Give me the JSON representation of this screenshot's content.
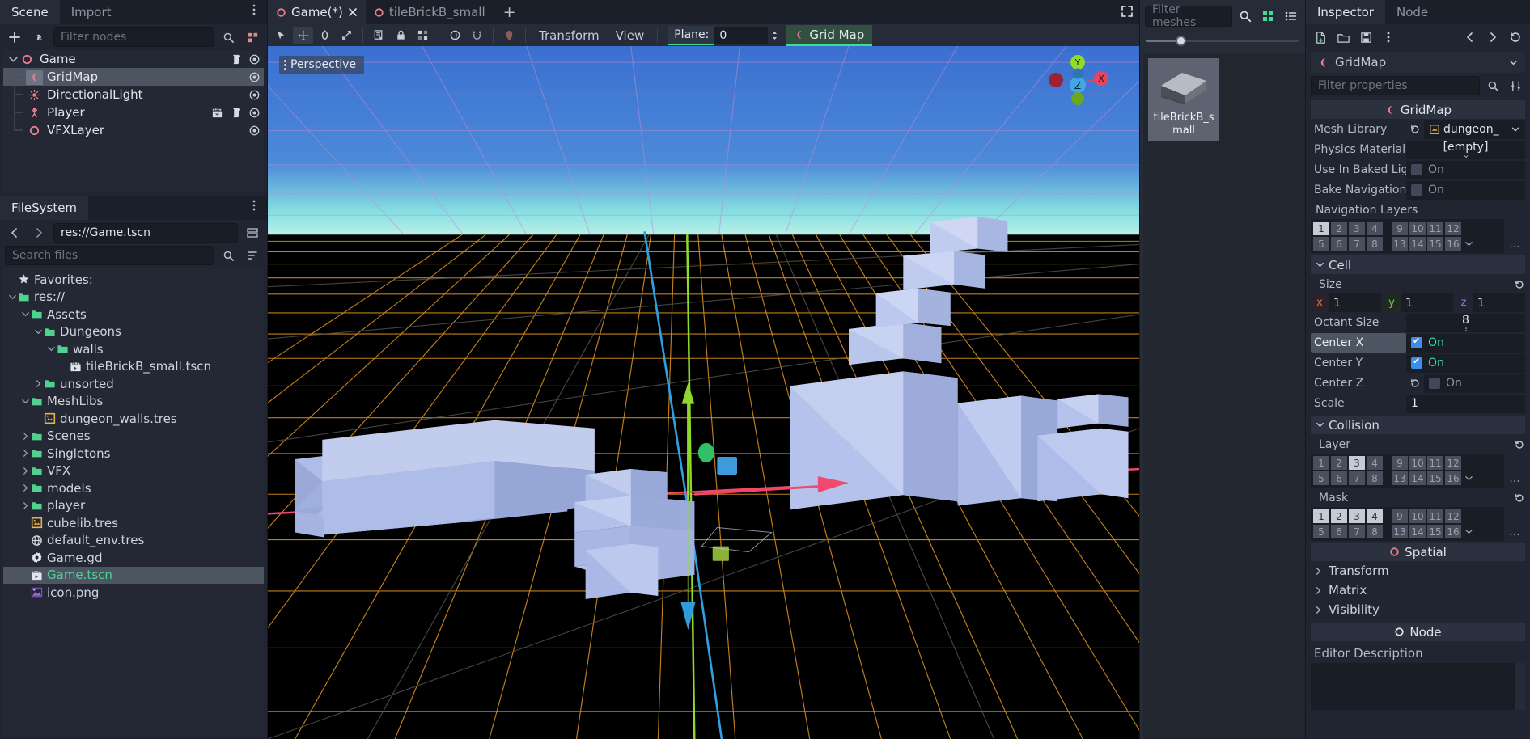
{
  "scene_panel": {
    "tabs": [
      {
        "label": "Scene",
        "active": true
      },
      {
        "label": "Import",
        "active": false
      }
    ],
    "filter_placeholder": "Filter nodes",
    "add_icon": "plus-icon",
    "link_icon": "link-icon",
    "menu_icon": "kebab-menu-icon",
    "nodes": [
      {
        "label": "Game",
        "depth": 0,
        "icon": "spatial-node-icon",
        "selected": false,
        "expanded": true,
        "extra_icons": [
          "script-icon"
        ]
      },
      {
        "label": "GridMap",
        "depth": 1,
        "icon": "gridmap-node-icon",
        "selected": true,
        "expanded": false,
        "extra_icons": []
      },
      {
        "label": "DirectionalLight",
        "depth": 1,
        "icon": "directional-light-icon",
        "selected": false,
        "expanded": false,
        "extra_icons": []
      },
      {
        "label": "Player",
        "depth": 1,
        "icon": "player-node-icon",
        "selected": false,
        "expanded": false,
        "extra_icons": [
          "group-icon",
          "script-icon"
        ]
      },
      {
        "label": "VFXLayer",
        "depth": 1,
        "icon": "spatial-node-icon",
        "selected": false,
        "expanded": false,
        "extra_icons": []
      }
    ]
  },
  "filesystem": {
    "title": "FileSystem",
    "path_value": "res://Game.tscn",
    "search_placeholder": "Search files",
    "back_icon": "chevron-left-icon",
    "forward_icon": "chevron-right-icon",
    "split_icon": "split-mode-icon",
    "sort_icon": "sort-icon",
    "items": [
      {
        "label": "Favorites:",
        "depth": 0,
        "icon": "star-icon",
        "arrow": "",
        "selected": false
      },
      {
        "label": "res://",
        "depth": 0,
        "icon": "folder-icon",
        "arrow": "v",
        "selected": false
      },
      {
        "label": "Assets",
        "depth": 1,
        "icon": "folder-icon",
        "arrow": "v",
        "selected": false
      },
      {
        "label": "Dungeons",
        "depth": 2,
        "icon": "folder-icon",
        "arrow": "v",
        "selected": false
      },
      {
        "label": "walls",
        "depth": 3,
        "icon": "folder-icon",
        "arrow": "v",
        "selected": false
      },
      {
        "label": "tileBrickB_small.tscn",
        "depth": 4,
        "icon": "scene-file-icon",
        "arrow": "",
        "selected": false
      },
      {
        "label": "unsorted",
        "depth": 2,
        "icon": "folder-icon",
        "arrow": ">",
        "selected": false
      },
      {
        "label": "MeshLibs",
        "depth": 1,
        "icon": "folder-icon",
        "arrow": "v",
        "selected": false
      },
      {
        "label": "dungeon_walls.tres",
        "depth": 2,
        "icon": "meshlib-icon",
        "arrow": "",
        "selected": false
      },
      {
        "label": "Scenes",
        "depth": 1,
        "icon": "folder-icon",
        "arrow": ">",
        "selected": false
      },
      {
        "label": "Singletons",
        "depth": 1,
        "icon": "folder-icon",
        "arrow": ">",
        "selected": false
      },
      {
        "label": "VFX",
        "depth": 1,
        "icon": "folder-icon",
        "arrow": ">",
        "selected": false
      },
      {
        "label": "models",
        "depth": 1,
        "icon": "folder-icon",
        "arrow": ">",
        "selected": false
      },
      {
        "label": "player",
        "depth": 1,
        "icon": "folder-icon",
        "arrow": ">",
        "selected": false
      },
      {
        "label": "cubelib.tres",
        "depth": 1,
        "icon": "meshlib-icon",
        "arrow": "",
        "selected": false
      },
      {
        "label": "default_env.tres",
        "depth": 1,
        "icon": "environment-icon",
        "arrow": "",
        "selected": false
      },
      {
        "label": "Game.gd",
        "depth": 1,
        "icon": "gdscript-icon",
        "arrow": "",
        "selected": false
      },
      {
        "label": "Game.tscn",
        "depth": 1,
        "icon": "scene-file-icon",
        "arrow": "",
        "selected": true
      },
      {
        "label": "icon.png",
        "depth": 1,
        "icon": "image-file-icon",
        "arrow": "",
        "selected": false
      }
    ]
  },
  "editor_tabs": {
    "items": [
      {
        "label": "Game(*)",
        "active": true,
        "closable": true
      },
      {
        "label": "tileBrickB_small",
        "active": false,
        "closable": false
      }
    ],
    "add_label": "+",
    "fullscreen_icon": "fullscreen-icon"
  },
  "viewport_toolbar": {
    "tools": [
      {
        "name": "select-mode-tool",
        "active": false
      },
      {
        "name": "move-mode-tool",
        "active": true
      },
      {
        "name": "rotate-mode-tool",
        "active": false
      },
      {
        "name": "scale-mode-tool",
        "active": false
      },
      {
        "name": "list-select-tool",
        "active": false
      },
      {
        "name": "lock-tool",
        "active": false
      },
      {
        "name": "group-tool",
        "active": false
      },
      {
        "name": "local-space-tool",
        "active": false
      },
      {
        "name": "snap-mode-tool",
        "active": false
      },
      {
        "name": "shading-tool",
        "active": false
      }
    ],
    "menus": [
      "Transform",
      "View"
    ],
    "plane_label": "Plane:",
    "plane_value": "0",
    "gridmap_label": "Grid Map"
  },
  "viewport": {
    "perspective_label": "Perspective",
    "axis_x": "X",
    "axis_y": "Y",
    "axis_z": "Z",
    "sky_top_color": "#3a6fd0",
    "sky_horizon_color": "#86e0e2",
    "ground_color": "#000000",
    "grid_color": "#d08a1e",
    "x_axis_color": "#f2486d",
    "y_axis_color": "#8fdc2b",
    "z_axis_color": "#2f9fe0",
    "box_color": "#aebde8"
  },
  "mesh_library": {
    "filter_placeholder": "Filter meshes",
    "search_icon": "search-icon",
    "grid_view_icon": "grid-view-icon",
    "list_view_icon": "list-view-icon",
    "items": [
      {
        "label": "tileBrickB_small",
        "selected": true
      }
    ]
  },
  "inspector": {
    "tabs": [
      {
        "label": "Inspector",
        "active": true
      },
      {
        "label": "Node",
        "active": false
      }
    ],
    "toolbar_icons": [
      "new-resource-icon",
      "load-resource-icon",
      "save-resource-icon",
      "kebab-menu-icon",
      "history-back-icon",
      "history-forward-icon",
      "history-icon",
      "open-docs-icon"
    ],
    "selected_object": "GridMap",
    "filter_placeholder": "Filter properties",
    "object_tools_icon": "object-tools-icon",
    "class_header": "GridMap",
    "properties": [
      {
        "name": "Mesh Library",
        "type": "resource",
        "value": "dungeon_",
        "revert": true,
        "dropdown": true
      },
      {
        "name": "Physics Material",
        "type": "resource",
        "value": "[empty]",
        "revert": false,
        "dropdown": true
      },
      {
        "name": "Use In Baked Light",
        "type": "bool",
        "value": false,
        "on_label": "On"
      },
      {
        "name": "Bake Navigation",
        "type": "bool",
        "value": false,
        "on_label": "On"
      }
    ],
    "navigation_layers": {
      "label": "Navigation Layers",
      "row1": [
        {
          "n": "1",
          "on": true
        },
        {
          "n": "2",
          "on": false
        },
        {
          "n": "3",
          "on": false
        },
        {
          "n": "4",
          "on": false
        },
        {
          "n": "9",
          "on": false
        },
        {
          "n": "10",
          "on": false
        },
        {
          "n": "11",
          "on": false
        },
        {
          "n": "12",
          "on": false
        }
      ],
      "row2": [
        {
          "n": "5",
          "on": false
        },
        {
          "n": "6",
          "on": false
        },
        {
          "n": "7",
          "on": false
        },
        {
          "n": "8",
          "on": false
        },
        {
          "n": "13",
          "on": false
        },
        {
          "n": "14",
          "on": false
        },
        {
          "n": "15",
          "on": false
        },
        {
          "n": "16",
          "on": false
        }
      ],
      "more": "..."
    },
    "cell_section": {
      "label": "Cell",
      "size_label": "Size",
      "size": {
        "x": "1",
        "y": "1",
        "z": "1",
        "x_key": "x",
        "y_key": "y",
        "z_key": "z"
      },
      "octant_label": "Octant Size",
      "octant_value": "8",
      "center_x": {
        "label": "Center X",
        "value": true,
        "on_label": "On",
        "highlighted": true
      },
      "center_y": {
        "label": "Center Y",
        "value": true,
        "on_label": "On",
        "highlighted": false
      },
      "center_z": {
        "label": "Center Z",
        "value": false,
        "on_label": "On",
        "highlighted": false,
        "revert": true
      },
      "scale_label": "Scale",
      "scale_value": "1"
    },
    "collision_section": {
      "label": "Collision",
      "layer_label": "Layer",
      "layer_row1": [
        {
          "n": "1",
          "on": false
        },
        {
          "n": "2",
          "on": false
        },
        {
          "n": "3",
          "on": true
        },
        {
          "n": "4",
          "on": false
        },
        {
          "n": "9",
          "on": false
        },
        {
          "n": "10",
          "on": false
        },
        {
          "n": "11",
          "on": false
        },
        {
          "n": "12",
          "on": false
        }
      ],
      "layer_row2": [
        {
          "n": "5",
          "on": false
        },
        {
          "n": "6",
          "on": false
        },
        {
          "n": "7",
          "on": false
        },
        {
          "n": "8",
          "on": false
        },
        {
          "n": "13",
          "on": false
        },
        {
          "n": "14",
          "on": false
        },
        {
          "n": "15",
          "on": false
        },
        {
          "n": "16",
          "on": false
        }
      ],
      "mask_label": "Mask",
      "mask_row1": [
        {
          "n": "1",
          "on": true
        },
        {
          "n": "2",
          "on": true
        },
        {
          "n": "3",
          "on": true
        },
        {
          "n": "4",
          "on": true
        },
        {
          "n": "9",
          "on": false
        },
        {
          "n": "10",
          "on": false
        },
        {
          "n": "11",
          "on": false
        },
        {
          "n": "12",
          "on": false
        }
      ],
      "mask_row2": [
        {
          "n": "5",
          "on": false
        },
        {
          "n": "6",
          "on": false
        },
        {
          "n": "7",
          "on": false
        },
        {
          "n": "8",
          "on": false
        },
        {
          "n": "13",
          "on": false
        },
        {
          "n": "14",
          "on": false
        },
        {
          "n": "15",
          "on": false
        },
        {
          "n": "16",
          "on": false
        }
      ],
      "more": "..."
    },
    "spatial_header": "Spatial",
    "spatial_sections": [
      "Transform",
      "Matrix",
      "Visibility"
    ],
    "node_header": "Node",
    "editor_description_label": "Editor Description"
  },
  "colors": {
    "accent_green": "#3ddc97",
    "node_pink": "#e97c8d",
    "folder_green": "#51d190",
    "resource_orange": "#e8b24a",
    "selection": "#4d5563",
    "panel_bg": "#202531",
    "darker_bg": "#1b1f29"
  }
}
